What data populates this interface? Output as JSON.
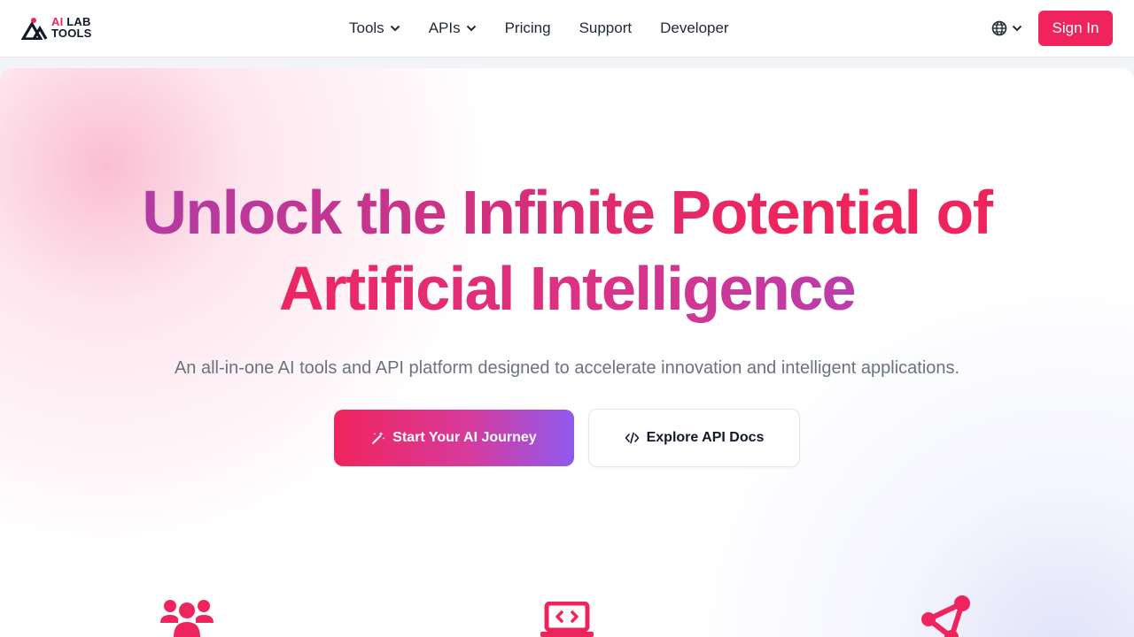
{
  "brand": {
    "logo_ai": "AI",
    "logo_lab": "LAB",
    "logo_tools": "TOOLS",
    "accent_color": "#f0245c"
  },
  "nav": {
    "items": [
      {
        "label": "Tools",
        "has_dropdown": true
      },
      {
        "label": "APIs",
        "has_dropdown": true
      },
      {
        "label": "Pricing",
        "has_dropdown": false
      },
      {
        "label": "Support",
        "has_dropdown": false
      },
      {
        "label": "Developer",
        "has_dropdown": false
      }
    ],
    "language_icon": "globe-icon",
    "signin_label": "Sign In"
  },
  "hero": {
    "headline_line1": "Unlock the Infinite Potential of",
    "headline_line2": "Artificial Intelligence",
    "subtitle": "An all-in-one AI tools and API platform designed to accelerate innovation and intelligent applications.",
    "primary_cta": {
      "label": "Start Your AI Journey",
      "icon": "magic-wand-icon"
    },
    "secondary_cta": {
      "label": "Explore API Docs",
      "icon": "code-icon"
    }
  },
  "features": {
    "icons": [
      "users-icon",
      "laptop-code-icon",
      "share-nodes-icon"
    ]
  }
}
